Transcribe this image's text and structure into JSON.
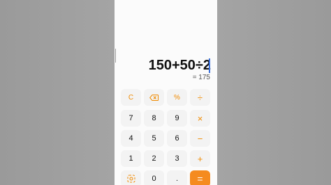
{
  "calculator": {
    "expression": "150+50÷2",
    "result": "= 175"
  },
  "keys": {
    "clear": "C",
    "backspace_icon": "backspace-icon",
    "percent": "%",
    "divide": "÷",
    "seven": "7",
    "eight": "8",
    "nine": "9",
    "multiply": "×",
    "four": "4",
    "five": "5",
    "six": "6",
    "subtract": "−",
    "one": "1",
    "two": "2",
    "three": "3",
    "add": "+",
    "mode_icon": "convert-icon",
    "zero": "0",
    "decimal": ".",
    "equals": "="
  },
  "colors": {
    "accent": "#f08a00",
    "equals_bg": "#f58b1f",
    "key_bg": "#f3f3f3",
    "background": "#fbfbfb"
  }
}
